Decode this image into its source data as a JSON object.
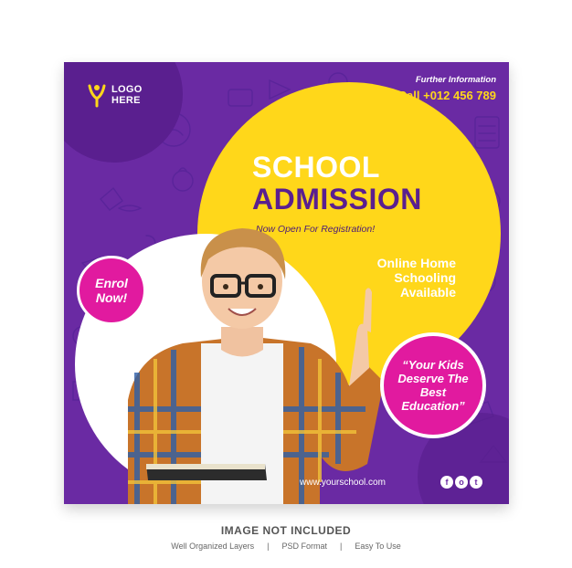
{
  "flyer": {
    "logo_line1": "LOGO",
    "logo_line2": "HERE",
    "info_label": "Further Information",
    "phone": "Call +012 456 789",
    "title_line1": "SCHOOL",
    "title_line2": "ADMISSION",
    "subtitle": "Now Open For Registration!",
    "online_line1": "Online Home",
    "online_line2": "Schooling",
    "online_line3": "Available",
    "enrol_line1": "Enrol",
    "enrol_line2": "Now!",
    "quote": "“Your Kids Deserve The Best Education”",
    "website": "www.yourschool.com",
    "socials": [
      "f",
      "o",
      "t"
    ]
  },
  "footer": {
    "title": "IMAGE NOT INCLUDED",
    "items": [
      "Well Organized Layers",
      "PSD Format",
      "Easy To Use"
    ],
    "separator": "|"
  },
  "colors": {
    "purple": "#6a2aa3",
    "dark_purple": "#5a1f8f",
    "yellow": "#ffd71a",
    "magenta": "#e11a9f"
  }
}
